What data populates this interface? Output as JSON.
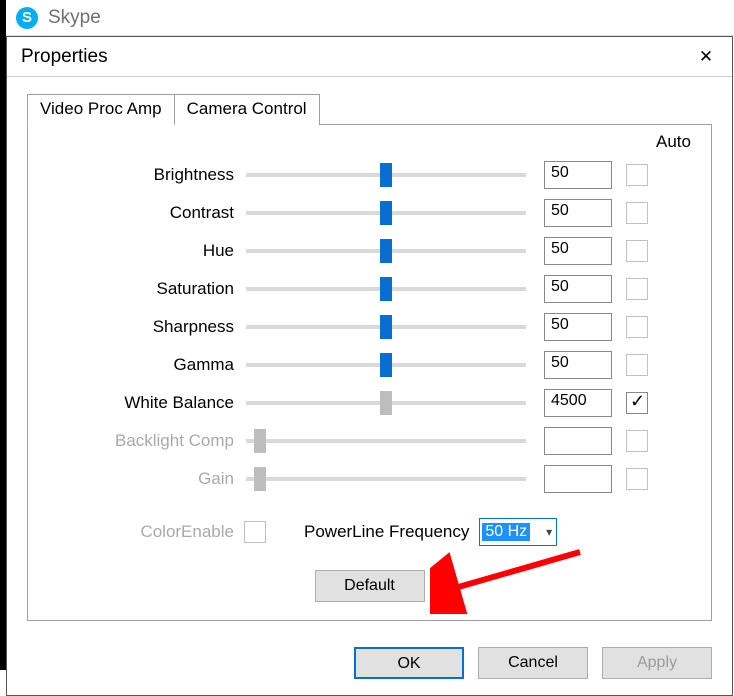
{
  "app": {
    "name": "Skype"
  },
  "dialog": {
    "title": "Properties",
    "tabs": [
      "Video Proc Amp",
      "Camera Control"
    ],
    "active_tab": 0,
    "auto_header": "Auto",
    "sliders": [
      {
        "label": "Brightness",
        "value": "50",
        "pos": 50,
        "enabled": true,
        "thumb": "blue",
        "auto_checked": false,
        "auto_enabled": false
      },
      {
        "label": "Contrast",
        "value": "50",
        "pos": 50,
        "enabled": true,
        "thumb": "blue",
        "auto_checked": false,
        "auto_enabled": false
      },
      {
        "label": "Hue",
        "value": "50",
        "pos": 50,
        "enabled": true,
        "thumb": "blue",
        "auto_checked": false,
        "auto_enabled": false
      },
      {
        "label": "Saturation",
        "value": "50",
        "pos": 50,
        "enabled": true,
        "thumb": "blue",
        "auto_checked": false,
        "auto_enabled": false
      },
      {
        "label": "Sharpness",
        "value": "50",
        "pos": 50,
        "enabled": true,
        "thumb": "blue",
        "auto_checked": false,
        "auto_enabled": false
      },
      {
        "label": "Gamma",
        "value": "50",
        "pos": 50,
        "enabled": true,
        "thumb": "blue",
        "auto_checked": false,
        "auto_enabled": false
      },
      {
        "label": "White Balance",
        "value": "4500",
        "pos": 50,
        "enabled": true,
        "thumb": "gray",
        "auto_checked": true,
        "auto_enabled": true
      },
      {
        "label": "Backlight Comp",
        "value": "",
        "pos": 5,
        "enabled": false,
        "thumb": "gray",
        "auto_checked": false,
        "auto_enabled": false
      },
      {
        "label": "Gain",
        "value": "",
        "pos": 5,
        "enabled": false,
        "thumb": "gray",
        "auto_checked": false,
        "auto_enabled": false
      }
    ],
    "color_enable": {
      "label": "ColorEnable",
      "checked": false
    },
    "powerline": {
      "label": "PowerLine Frequency",
      "value": "50 Hz"
    },
    "default_button": "Default",
    "buttons": {
      "ok": "OK",
      "cancel": "Cancel",
      "apply": "Apply"
    }
  }
}
